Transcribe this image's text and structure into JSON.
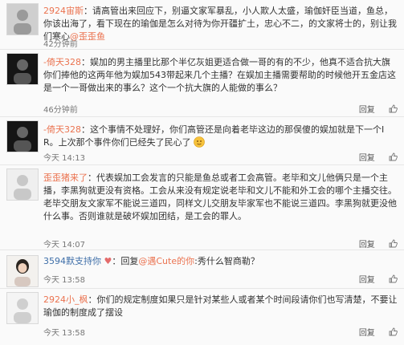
{
  "comments": [
    {
      "user": "2924宙斯",
      "text": "：请高管出来回应下，别逼文家军暴乱，小人欺人太盛，瑜伽奸臣当道，鱼总，你该出海了，看下现在的瑜伽是怎么对待为你开疆扩土，忠心不二，的文家将士的，别让我们寒心",
      "mention": "@歪歪鱼",
      "time": "42分钟前",
      "actions": []
    },
    {
      "user": "-倚天328",
      "text": "：娱加的男主播里比那个半亿灰姐更适合做一哥的有的不少，他真不适合抗大旗你们捧他的这两年他为娱加543带起来几个主播？在娱加主播需要帮助的时候他开五金店这是一个一哥做出来的事么？这个一个抗大旗的人能做的事么？",
      "time": "46分钟前",
      "actions": [
        "回复",
        "赞"
      ]
    },
    {
      "user": "-倚天328",
      "text": "：这个事情不处理好，你们高管还是向着老毕这边的那俣傻的娱加就是下一个IR。上次那个事件你们已经失了民心了",
      "time": "今天 14:13",
      "actions": [
        "回复",
        "赞"
      ]
    },
    {
      "user": "歪歪猪来了",
      "text": "：代表娱加工会发言的只能是鱼总或者工会高管。老毕和文儿他俩只是一个主播，李黑狗就更没有资格。工会从来没有规定说老毕和文儿不能和外工会的哪个主播交往。老毕交朋友文家军不能说三道四，同样文儿交朋友毕家军也不能说三道四。李黑狗就更没他什么事。否则谁就是破坏娱加团结，是工会的罪人。",
      "time": "今天 14:07",
      "actions": [
        "回复",
        "赞"
      ]
    },
    {
      "user": "3594默支持你",
      "text": "：回复",
      "mention": "@遇Cute的你",
      "text2": ":秀什么智商勒？",
      "time": "今天 13:58",
      "actions": [
        "回复",
        "赞"
      ]
    },
    {
      "user": "2924小_枫",
      "text": "：你们的规定制度如果只是针对某些人或者某个时间段请你们也写清楚，不要让瑜伽的制度成了摆设",
      "time": "今天 13:58",
      "actions": [
        "回复",
        "赞"
      ]
    }
  ]
}
